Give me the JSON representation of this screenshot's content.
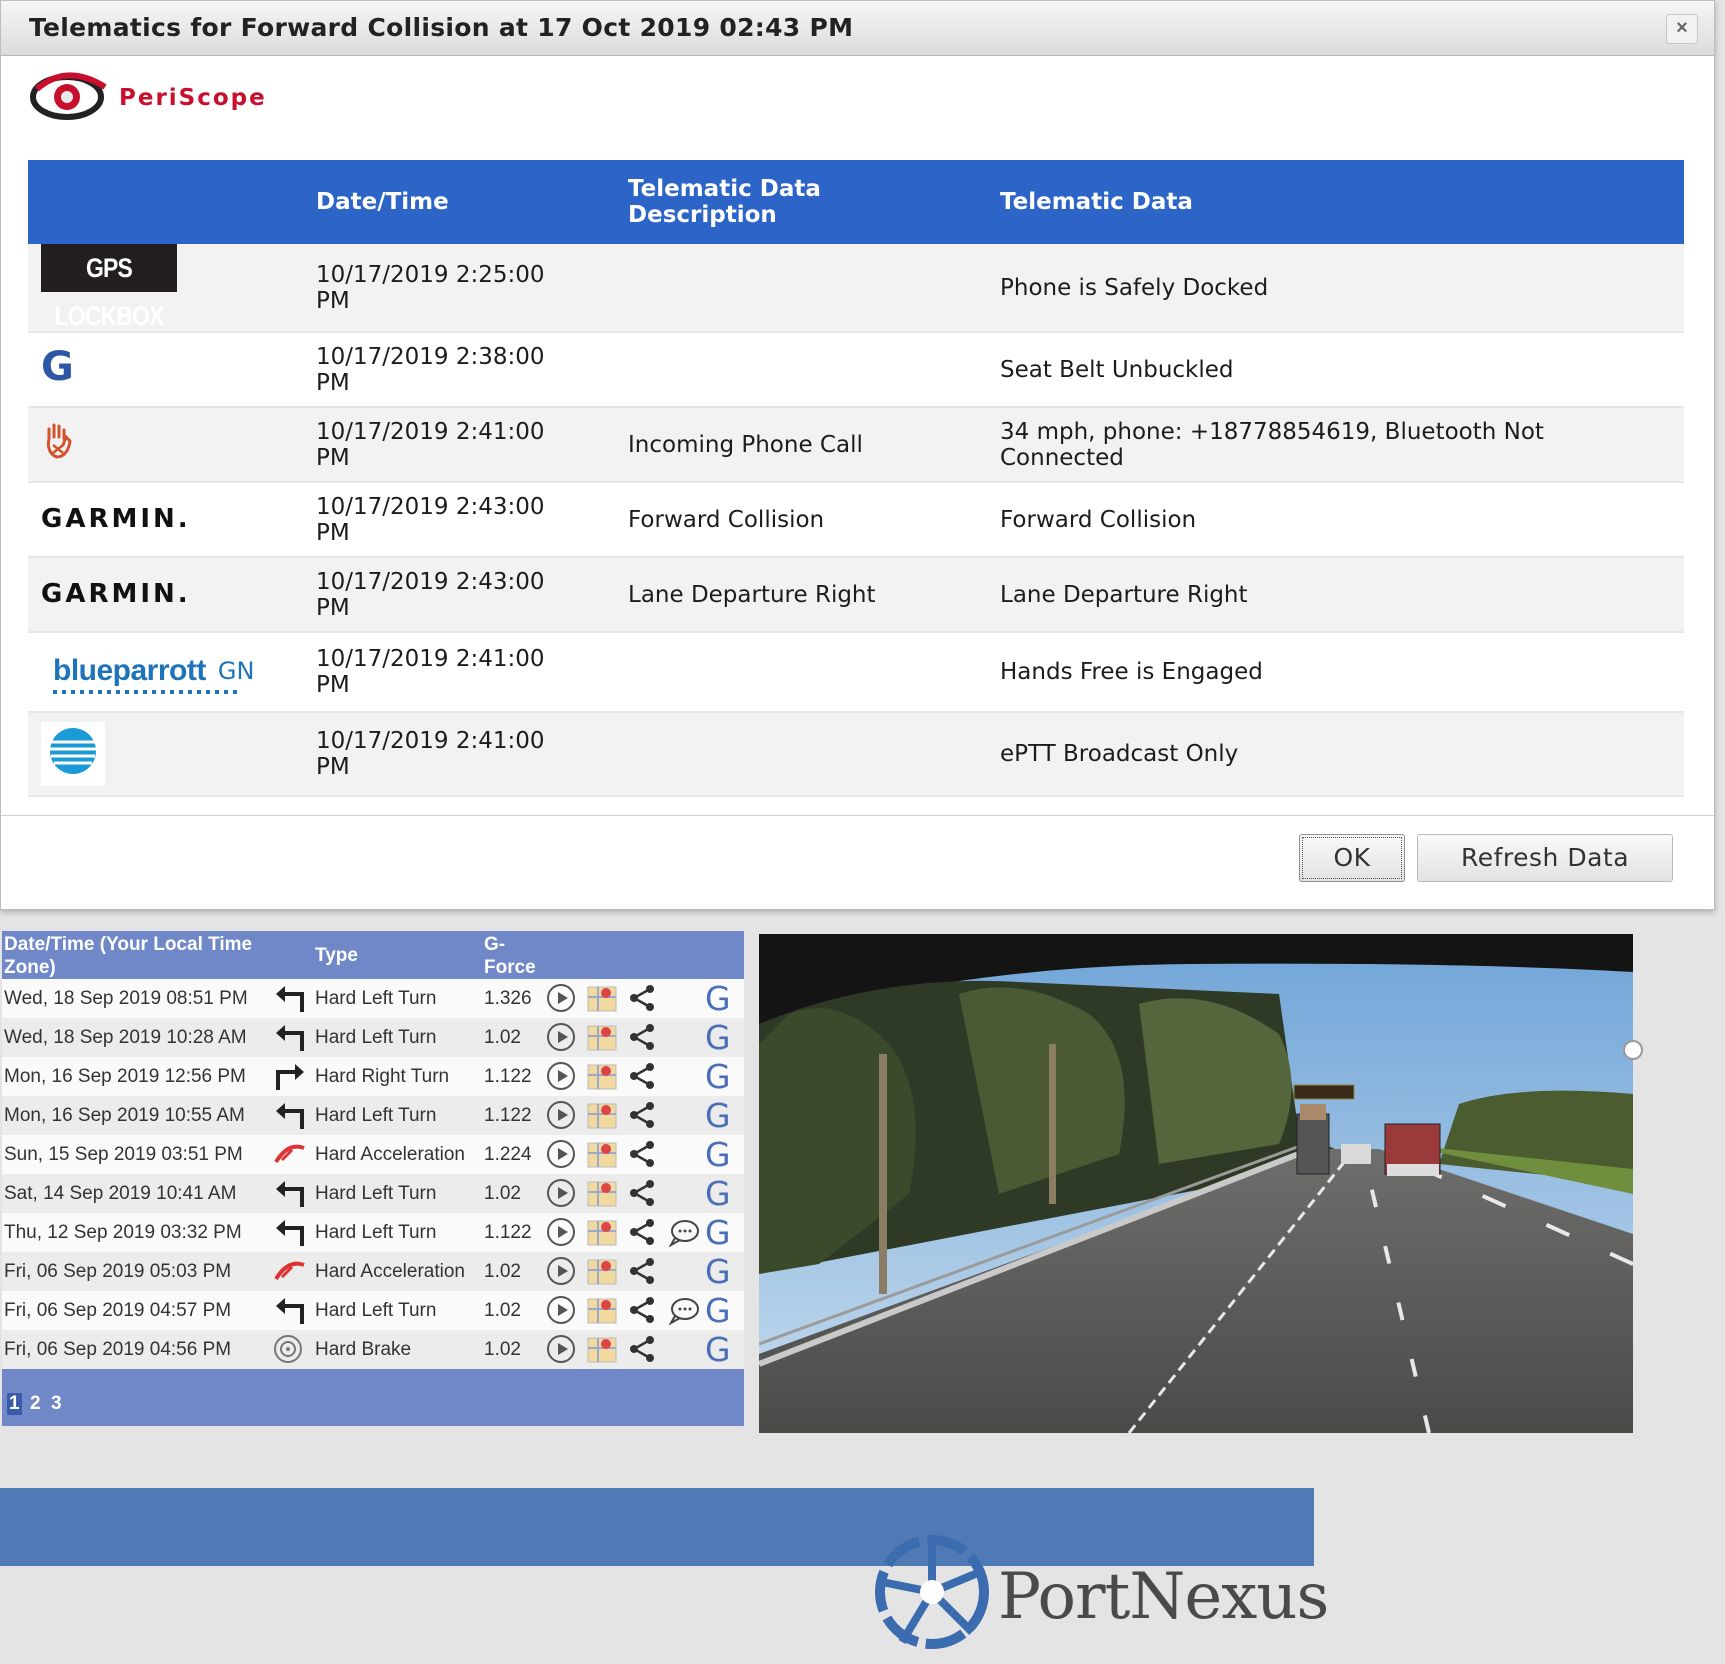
{
  "dialog": {
    "title": "Telematics for Forward Collision at 17 Oct 2019 02:43 PM",
    "close_label": "×",
    "brand_name": "PeriScope",
    "headers": {
      "source": "",
      "datetime": "Date/Time",
      "description": "Telematic Data Description",
      "data": "Telematic Data"
    },
    "rows": [
      {
        "source": "GPS LOCKBOX",
        "datetime": "10/17/2019 2:25:00 PM",
        "description": "",
        "data": "Phone is Safely Docked"
      },
      {
        "source": "G",
        "datetime": "10/17/2019 2:38:00 PM",
        "description": "",
        "data": "Seat Belt Unbuckled"
      },
      {
        "source": "hand-logo",
        "datetime": "10/17/2019 2:41:00 PM",
        "description": "Incoming Phone Call",
        "data": "34 mph, phone: +18778854619, Bluetooth Not Connected"
      },
      {
        "source": "GARMIN.",
        "datetime": "10/17/2019 2:43:00 PM",
        "description": "Forward Collision",
        "data": "Forward Collision"
      },
      {
        "source": "GARMIN.",
        "datetime": "10/17/2019 2:43:00 PM",
        "description": "Lane Departure Right",
        "data": "Lane Departure Right"
      },
      {
        "source": "blueparrott GN",
        "datetime": "10/17/2019 2:41:00 PM",
        "description": "",
        "data": "Hands Free is Engaged"
      },
      {
        "source": "att-globe-logo",
        "datetime": "10/17/2019 2:41:00 PM",
        "description": "",
        "data": "ePTT Broadcast Only"
      }
    ],
    "ok_label": "OK",
    "refresh_label": "Refresh Data"
  },
  "events": {
    "headers": {
      "datetime": "Date/Time (Your Local Time Zone)",
      "type": "Type",
      "gforce": "G-Force"
    },
    "rows": [
      {
        "datetime": "Wed, 18 Sep 2019 08:51 PM",
        "type": "Hard Left Turn",
        "icon": "left-turn-icon",
        "gforce": "1.326",
        "chat": false
      },
      {
        "datetime": "Wed, 18 Sep 2019 10:28 AM",
        "type": "Hard Left Turn",
        "icon": "left-turn-icon",
        "gforce": "1.02",
        "chat": false
      },
      {
        "datetime": "Mon, 16 Sep 2019 12:56 PM",
        "type": "Hard Right Turn",
        "icon": "right-turn-icon",
        "gforce": "1.122",
        "chat": false
      },
      {
        "datetime": "Mon, 16 Sep 2019 10:55 AM",
        "type": "Hard Left Turn",
        "icon": "left-turn-icon",
        "gforce": "1.122",
        "chat": false
      },
      {
        "datetime": "Sun, 15 Sep 2019 03:51 PM",
        "type": "Hard Acceleration",
        "icon": "acceleration-icon",
        "gforce": "1.224",
        "chat": false
      },
      {
        "datetime": "Sat, 14 Sep 2019 10:41 AM",
        "type": "Hard Left Turn",
        "icon": "left-turn-icon",
        "gforce": "1.02",
        "chat": false
      },
      {
        "datetime": "Thu, 12 Sep 2019 03:32 PM",
        "type": "Hard Left Turn",
        "icon": "left-turn-icon",
        "gforce": "1.122",
        "chat": true
      },
      {
        "datetime": "Fri, 06 Sep 2019 05:03 PM",
        "type": "Hard Acceleration",
        "icon": "acceleration-icon",
        "gforce": "1.02",
        "chat": false
      },
      {
        "datetime": "Fri, 06 Sep 2019 04:57 PM",
        "type": "Hard Left Turn",
        "icon": "left-turn-icon",
        "gforce": "1.02",
        "chat": true
      },
      {
        "datetime": "Fri, 06 Sep 2019 04:56 PM",
        "type": "Hard Brake",
        "icon": "brake-icon",
        "gforce": "1.02",
        "chat": false
      }
    ],
    "row_link_label": "G",
    "pages": [
      "1",
      "2",
      "3"
    ],
    "current_page": "1"
  },
  "footer": {
    "company": "PortNexus"
  },
  "colors": {
    "dialog_header": "#2c64c7",
    "events_header": "#7088c8",
    "footer_band": "#4f7ab5",
    "brand_red": "#c8102e"
  }
}
